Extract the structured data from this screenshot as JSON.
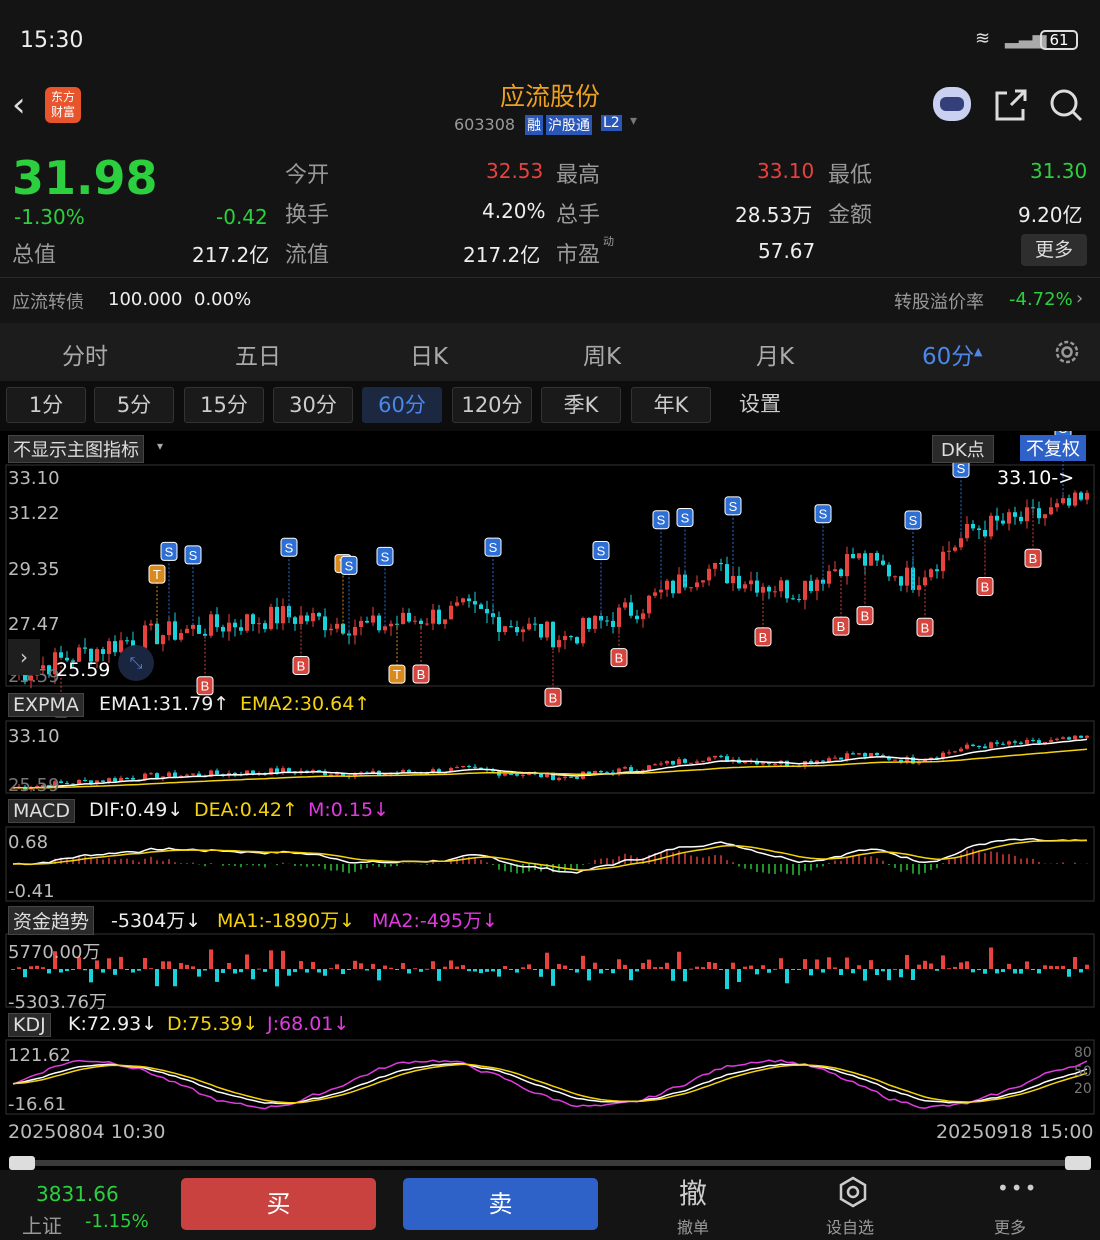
{
  "status": {
    "time": "15:30",
    "battery": "61"
  },
  "header": {
    "app_logo_text": "东方\n财富",
    "title": "应流股份",
    "code": "603308",
    "badges": [
      "融",
      "沪股通",
      "L2"
    ]
  },
  "quote": {
    "price": "31.98",
    "change_pct": "-1.30%",
    "change": "-0.42",
    "open_label": "今开",
    "open": "32.53",
    "high_label": "最高",
    "high": "33.10",
    "low_label": "最低",
    "low": "31.30",
    "turnover_label": "换手",
    "turnover": "4.20%",
    "volume_label": "总手",
    "volume": "28.53万",
    "amount_label": "金额",
    "amount": "9.20亿",
    "mktcap_label": "总值",
    "mktcap": "217.2亿",
    "float_label": "流值",
    "float": "217.2亿",
    "pe_label": "市盈",
    "pe_sup": "动",
    "pe": "57.67",
    "more": "更多",
    "bond_label": "应流转债",
    "bond_price": "100.000",
    "bond_pct": "0.00%",
    "premium_label": "转股溢价率",
    "premium": "-4.72%"
  },
  "tabs": [
    "分时",
    "五日",
    "日K",
    "周K",
    "月K",
    "60分"
  ],
  "periods": [
    "1分",
    "5分",
    "15分",
    "30分",
    "60分",
    "120分",
    "季K",
    "年K",
    "设置"
  ],
  "main_chart": {
    "indicator_select": "不显示主图指标",
    "dk_label": "DK点",
    "adjust": "不复权",
    "y_ticks": [
      "33.10",
      "31.22",
      "29.35",
      "27.47",
      "25.59"
    ],
    "max_label": "33.10->",
    "min_label": "25.59"
  },
  "expma": {
    "name": "EXPMA",
    "ema1": "EMA1:31.79↑",
    "ema2": "EMA2:30.64↑",
    "top": "33.10",
    "bottom": "25.59"
  },
  "macd": {
    "name": "MACD",
    "dif": "DIF:0.49↓",
    "dea": "DEA:0.42↑",
    "m": "M:0.15↓",
    "top": "0.68",
    "bottom": "-0.41"
  },
  "flow": {
    "name": "资金趋势",
    "value": "-5304万↓",
    "ma1": "MA1:-1890万↓",
    "ma2": "MA2:-495万↓",
    "top": "5770.00万",
    "bottom": "-5303.76万"
  },
  "kdj": {
    "name": "KDJ",
    "k": "K:72.93↓",
    "d": "D:75.39↓",
    "j": "J:68.01↓",
    "top": "121.62",
    "bottom": "-16.61",
    "right_ticks": [
      "80",
      "50",
      "20"
    ]
  },
  "dates": {
    "start": "20250804 10:30",
    "end": "20250918 15:00"
  },
  "bottom": {
    "index_value": "3831.66",
    "index_name": "上证",
    "index_pct": "-1.15%",
    "buy": "买",
    "sell": "卖",
    "cancel_icon": "撤",
    "cancel": "撤单",
    "fav": "设自选",
    "more": "更多"
  },
  "colors": {
    "up": "#e8423f",
    "down": "#2ccf3e",
    "candle_down": "#19d3dc",
    "dif": "#ffffff",
    "dea": "#f5d30c",
    "j": "#e03ae0",
    "accent": "#4c86e8",
    "buy_btn": "#c9423f",
    "sell_btn": "#2f62c9"
  }
}
